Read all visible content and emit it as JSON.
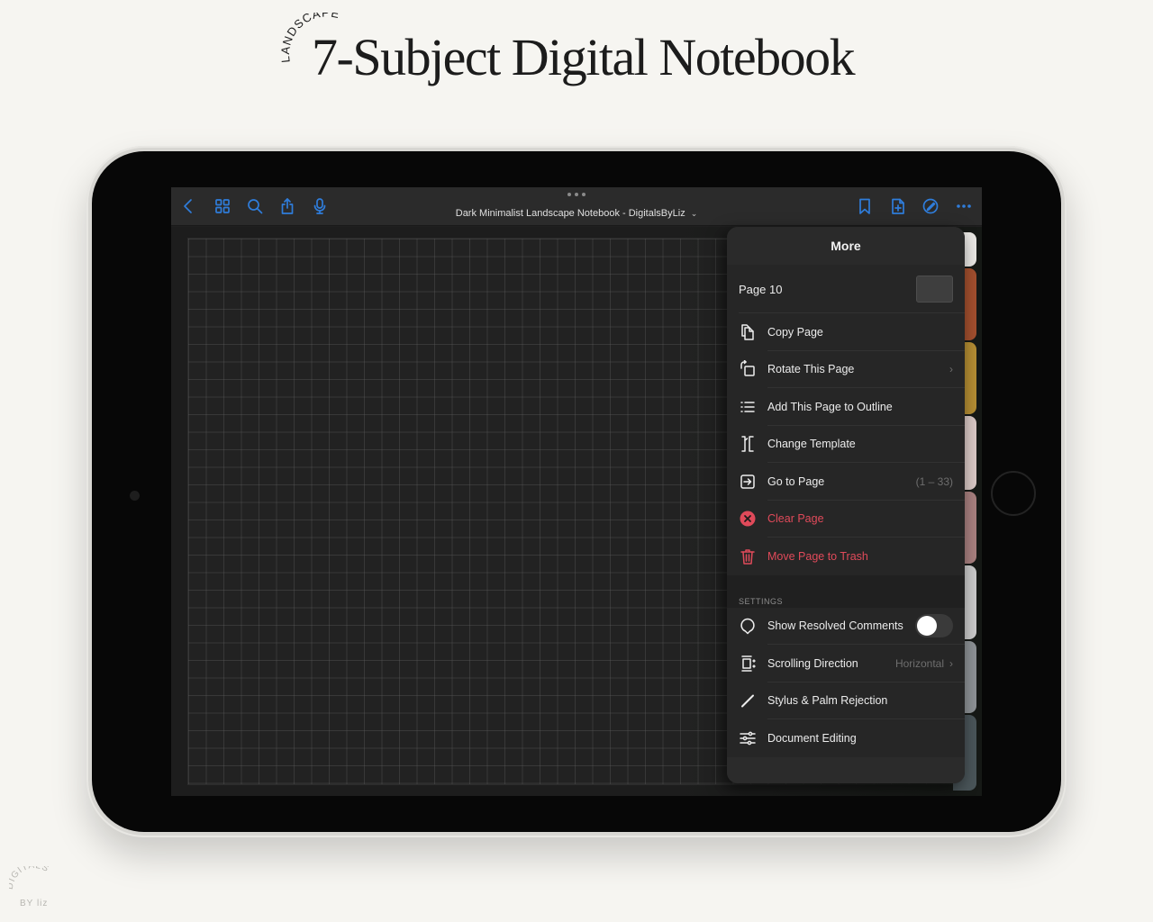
{
  "hero": {
    "subtitle": "LANDSCAPE",
    "title": "7-Subject Digital Notebook"
  },
  "toolbar": {
    "left_icons": [
      "back-chevron",
      "thumbnail-grid",
      "search",
      "share",
      "microphone"
    ],
    "right_icons": [
      "bookmark",
      "add-page",
      "markup-pencil",
      "more-ellipsis"
    ],
    "document_title": "Dark Minimalist Landscape Notebook - DigitalsByLiz",
    "title_chevron": "⌄",
    "accent_color": "#2f7ddb"
  },
  "tabs": {
    "colors": [
      "#e9e7e4",
      "#a24f2e",
      "#b48d33",
      "#d9c8c5",
      "#a8807f",
      "#cacaca",
      "#8d9295",
      "#4a5559"
    ]
  },
  "menu": {
    "title": "More",
    "page_label": "Page 10",
    "actions": [
      {
        "label": "Copy Page",
        "icon": "copy-page"
      },
      {
        "label": "Rotate This Page",
        "icon": "rotate-page",
        "chevron": "›"
      },
      {
        "label": "Add This Page to Outline",
        "icon": "outline-list"
      },
      {
        "label": "Change Template",
        "icon": "template"
      },
      {
        "label": "Go to Page",
        "icon": "go-to-page",
        "detail": "(1 – 33)"
      },
      {
        "label": "Clear Page",
        "icon": "clear-circle-x",
        "danger": true
      },
      {
        "label": "Move Page to Trash",
        "icon": "trash",
        "danger": true
      }
    ],
    "settings_label": "SETTINGS",
    "settings": [
      {
        "label": "Show Resolved Comments",
        "icon": "comment-bubble",
        "toggle": false
      },
      {
        "label": "Scrolling Direction",
        "icon": "scroll-direction",
        "detail": "Horizontal",
        "chevron": "›"
      },
      {
        "label": "Stylus & Palm Rejection",
        "icon": "stylus"
      },
      {
        "label": "Document Editing",
        "icon": "sliders"
      }
    ],
    "danger_color": "#e04a5a"
  },
  "watermark": {
    "line1": "DIGITALS",
    "line2": "BY liz"
  }
}
